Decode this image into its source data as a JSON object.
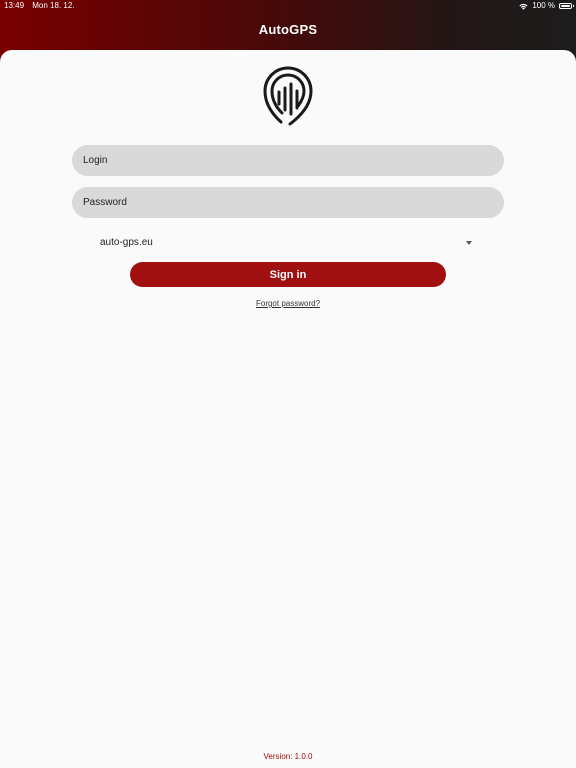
{
  "status_bar": {
    "time": "13:49",
    "date": "Mon 18. 12.",
    "wifi_icon": "wifi-icon",
    "battery_percent": "100 %",
    "battery_level": 1.0,
    "battery_icon": "battery-icon"
  },
  "header": {
    "title": "AutoGPS"
  },
  "logo": {
    "icon": "location-pin-signal-icon"
  },
  "form": {
    "login_placeholder": "Login",
    "login_value": "",
    "password_placeholder": "Password",
    "password_value": "",
    "server_selected": "auto-gps.eu",
    "signin_label": "Sign in",
    "forgot_password_label": "Forgot password?"
  },
  "footer": {
    "version": "Version: 1.0.0"
  },
  "colors": {
    "brand_red": "#a01010",
    "header_gradient_start": "#7a0000",
    "header_gradient_end": "#1c1c1c",
    "field_bg": "#d9d9d9",
    "sheet_bg": "#fafafa"
  }
}
